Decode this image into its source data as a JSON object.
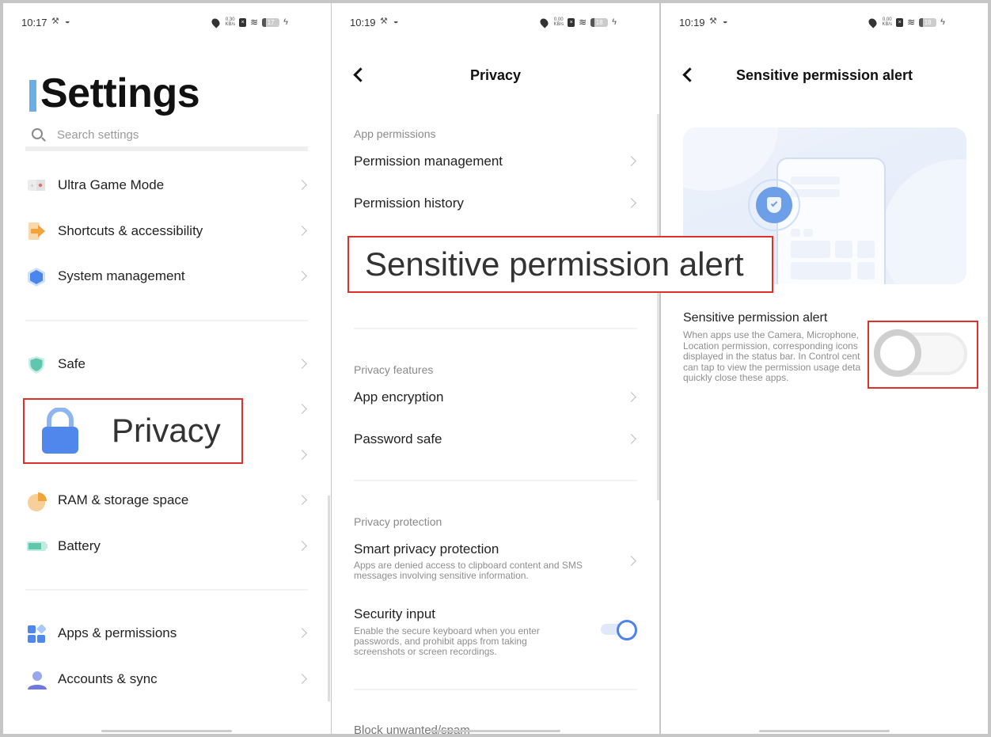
{
  "panel1": {
    "status": {
      "time": "10:17",
      "net_speed": "0.30",
      "net_unit": "KB/s",
      "battery": "17"
    },
    "title": "Settings",
    "search_placeholder": "Search settings",
    "groups": [
      [
        {
          "label": "Ultra Game Mode",
          "icon": "game-icon"
        },
        {
          "label": "Shortcuts & accessibility",
          "icon": "shortcut-arrow-icon"
        },
        {
          "label": "System management",
          "icon": "hexagon-icon"
        }
      ],
      [
        {
          "label": "Safe",
          "icon": "shield-icon"
        },
        {
          "label": "Privacy",
          "icon": "lock-icon"
        },
        {
          "label": "",
          "icon": ""
        },
        {
          "label": "RAM & storage space",
          "icon": "pie-chart-icon"
        },
        {
          "label": "Battery",
          "icon": "battery-icon"
        }
      ],
      [
        {
          "label": "Apps & permissions",
          "icon": "apps-grid-icon"
        },
        {
          "label": "Accounts & sync",
          "icon": "person-icon"
        }
      ]
    ],
    "highlight_label": "Privacy"
  },
  "panel2": {
    "status": {
      "time": "10:19",
      "net_speed": "0.00",
      "net_unit": "KB/s",
      "battery": "18"
    },
    "title": "Privacy",
    "sections": {
      "app_permissions": {
        "header": "App permissions",
        "items": [
          "Permission management",
          "Permission history"
        ]
      },
      "privacy_features": {
        "header": "Privacy features",
        "items": [
          "App encryption",
          "Password safe"
        ]
      },
      "privacy_protection": {
        "header": "Privacy protection",
        "smart": {
          "title": "Smart privacy protection",
          "desc": "Apps are denied access to clipboard content and SMS messages involving sensitive information."
        },
        "security_input": {
          "title": "Security input",
          "desc": "Enable the secure keyboard when you enter passwords, and prohibit apps from taking screenshots or screen recordings.",
          "enabled": true
        }
      },
      "block": {
        "header": "Block unwanted/spam"
      }
    },
    "highlight_label": "Sensitive permission alert"
  },
  "panel3": {
    "status": {
      "time": "10:19",
      "net_speed": "0.00",
      "net_unit": "KB/s",
      "battery": "18"
    },
    "title": "Sensitive permission alert",
    "setting": {
      "title": "Sensitive permission alert",
      "desc_lines": [
        "When apps use the Camera, Microphone,",
        "Location permission, corresponding icons",
        "displayed in the status bar. In Control cent",
        "can tap to view the permission usage deta",
        "quickly close these apps."
      ],
      "enabled": false
    }
  },
  "colors": {
    "accent_blue": "#4c83e8",
    "highlight_red": "#e0302a",
    "title_bar_blue": "#6aaee6"
  }
}
